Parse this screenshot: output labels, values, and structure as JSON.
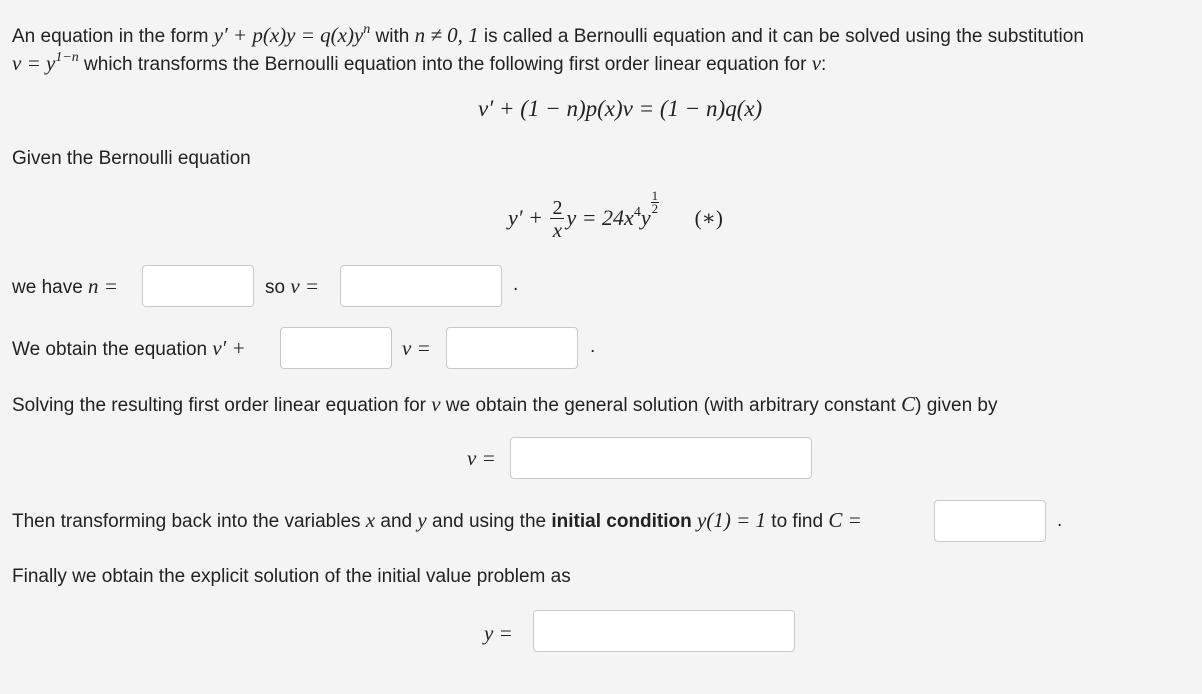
{
  "intro": {
    "line1_a": "An equation in the form ",
    "line1_eq": "y′ + p(x)y = q(x)y",
    "line1_eq_sup": "n",
    "line1_b": " with ",
    "line1_cond": "n ≠ 0, 1",
    "line1_c": " is called a Bernoulli equation and it can be solved using the substitution",
    "line2_eq": "v = y",
    "line2_eq_sup": "1−n",
    "line2_a": " which transforms the Bernoulli equation into the following first order linear equation for ",
    "line2_var": "v",
    "line2_end": ":"
  },
  "linear_equation": "v′ + (1 − n)p(x)v = (1 − n)q(x)",
  "given_label": "Given the Bernoulli equation",
  "bernoulli": {
    "lhs_a": "y′ + ",
    "frac_num": "2",
    "frac_den": "x",
    "lhs_b": "y = 24x",
    "exp4": "4",
    "y": "y",
    "exp_num": "1",
    "exp_den": "2",
    "tag": "(∗)"
  },
  "row_n": {
    "label_a": "we have ",
    "label_var": "n =",
    "label_so": "so ",
    "label_v": "v =",
    "n_value": "",
    "v_value": "",
    "period": "."
  },
  "row_eq": {
    "label_a": "We obtain the equation ",
    "label_eq": "v′ +",
    "coef_value": "",
    "v_eq": "v =",
    "rhs_value": "",
    "period": "."
  },
  "general": {
    "text_a": "Solving the resulting first order linear equation for ",
    "var": "v",
    "text_b": " we obtain the general solution (with arbitrary constant ",
    "const": "C",
    "text_c": ") given by",
    "v_label": "v =",
    "v_value": ""
  },
  "initial": {
    "text_a": "Then transforming back into the variables ",
    "x": "x",
    "and1": " and ",
    "y": "y",
    "text_b": " and using the ",
    "bold": "initial condition",
    "cond": "y(1) = 1",
    "text_c": " to find ",
    "c_label": "C =",
    "c_value": "",
    "period": "."
  },
  "final": {
    "text": "Finally we obtain the explicit solution of the initial value problem as",
    "y_label": "y =",
    "y_value": ""
  }
}
